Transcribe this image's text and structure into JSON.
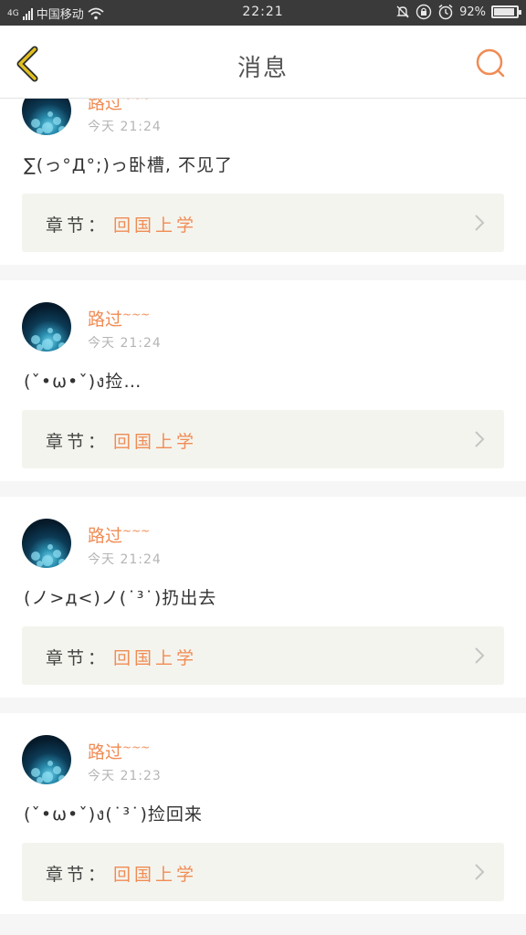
{
  "status_bar": {
    "network": "4G",
    "carrier": "中国移动",
    "time": "22:21",
    "battery": "92%",
    "battery_level": 0.92,
    "icons": [
      "signal-icon",
      "wifi-icon",
      "notification-muted-icon",
      "rotation-lock-icon",
      "alarm-icon",
      "battery-icon"
    ]
  },
  "header": {
    "title": "消息",
    "back_icon": "chevron-left-icon",
    "search_icon": "search-icon"
  },
  "colors": {
    "accent": "#f08c55",
    "back_icon": "#e0c020",
    "card_bg": "#ffffff",
    "chapter_bg": "#f4f4ee",
    "page_bg": "#f6f6f6"
  },
  "messages": [
    {
      "username": "路过",
      "username_suffix": "~~~",
      "time": "今天 21:24",
      "content": "∑(っ°Д°;)っ卧槽, 不见了",
      "chapter_label": "章节：",
      "chapter_name": "回国上学"
    },
    {
      "username": "路过",
      "username_suffix": "~~~",
      "time": "今天 21:24",
      "content": "(ˇ•ω•ˇ)ง捡…",
      "chapter_label": "章节：",
      "chapter_name": "回国上学"
    },
    {
      "username": "路过",
      "username_suffix": "~~~",
      "time": "今天 21:24",
      "content": "(ノ>д<)ノ(˙³˙)扔出去",
      "chapter_label": "章节：",
      "chapter_name": "回国上学"
    },
    {
      "username": "路过",
      "username_suffix": "~~~",
      "time": "今天 21:23",
      "content": "(ˇ•ω•ˇ)ง(˙³˙)捡回来",
      "chapter_label": "章节：",
      "chapter_name": "回国上学"
    }
  ]
}
